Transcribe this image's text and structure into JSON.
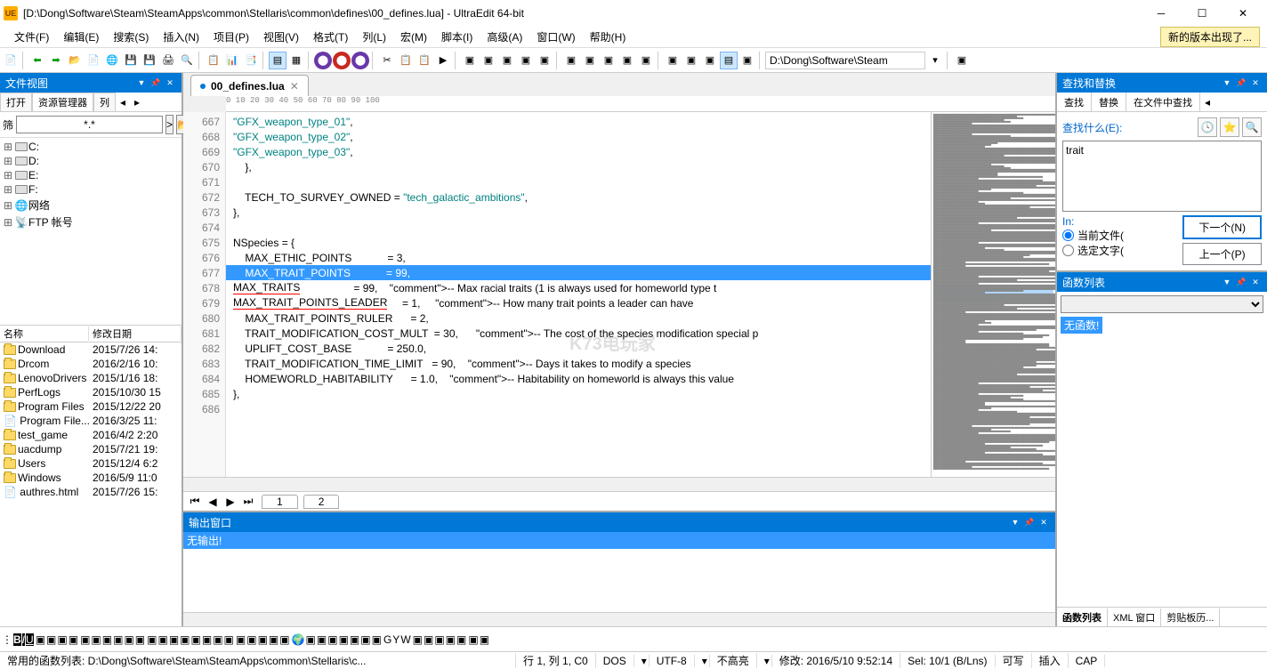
{
  "window": {
    "title": "[D:\\Dong\\Software\\Steam\\SteamApps\\common\\Stellaris\\common\\defines\\00_defines.lua] - UltraEdit 64-bit"
  },
  "menu": {
    "items": [
      "文件(F)",
      "编辑(E)",
      "搜索(S)",
      "插入(N)",
      "项目(P)",
      "视图(V)",
      "格式(T)",
      "列(L)",
      "宏(M)",
      "脚本(I)",
      "高级(A)",
      "窗口(W)",
      "帮助(H)"
    ],
    "update_notice": "新的版本出现了..."
  },
  "toolbar_path": "D:\\Dong\\Software\\Steam",
  "file_view": {
    "title": "文件视图",
    "tab_open": "打开",
    "tab_explorer": "资源管理器",
    "tab_list": "列",
    "filter_label": "筛",
    "filter_value": "*.*",
    "drives": [
      "C:",
      "D:",
      "E:",
      "F:"
    ],
    "network": "网络",
    "ftp": "FTP 帐号",
    "col_name": "名称",
    "col_date": "修改日期",
    "files": [
      {
        "name": "Download",
        "date": "2015/7/26 14:"
      },
      {
        "name": "Drcom",
        "date": "2016/2/16 10:"
      },
      {
        "name": "LenovoDrivers",
        "date": "2015/1/16 18:"
      },
      {
        "name": "PerfLogs",
        "date": "2015/10/30 15"
      },
      {
        "name": "Program Files",
        "date": "2015/12/22 20"
      },
      {
        "name": "Program File...",
        "date": "2016/3/25 11:"
      },
      {
        "name": "test_game",
        "date": "2016/4/2 2:20"
      },
      {
        "name": "uacdump",
        "date": "2015/7/21 19:"
      },
      {
        "name": "Users",
        "date": "2015/12/4 6:2"
      },
      {
        "name": "Windows",
        "date": "2016/5/9 11:0"
      },
      {
        "name": "authres.html",
        "date": "2015/7/26 15:"
      }
    ]
  },
  "editor": {
    "tab_name": "00_defines.lua",
    "lines": [
      {
        "n": 667,
        "t": "        \"GFX_weapon_type_01\","
      },
      {
        "n": 668,
        "t": "        \"GFX_weapon_type_02\","
      },
      {
        "n": 669,
        "t": "        \"GFX_weapon_type_03\","
      },
      {
        "n": 670,
        "t": "    },"
      },
      {
        "n": 671,
        "t": ""
      },
      {
        "n": 672,
        "t": "    TECH_TO_SURVEY_OWNED = \"tech_galactic_ambitions\","
      },
      {
        "n": 673,
        "t": "},"
      },
      {
        "n": 674,
        "t": ""
      },
      {
        "n": 675,
        "t": "NSpecies = {"
      },
      {
        "n": 676,
        "t": "    MAX_ETHIC_POINTS            = 3,"
      },
      {
        "n": 677,
        "t": "    MAX_TRAIT_POINTS            = 99,",
        "hl": true
      },
      {
        "n": 678,
        "t": "    MAX_TRAITS                  = 99,    -- Max racial traits (1 is always used for homeworld type t"
      },
      {
        "n": 679,
        "t": "    MAX_TRAIT_POINTS_LEADER     = 1,     -- How many trait points a leader can have"
      },
      {
        "n": 680,
        "t": "    MAX_TRAIT_POINTS_RULER      = 2,"
      },
      {
        "n": 681,
        "t": "    TRAIT_MODIFICATION_COST_MULT  = 30,      -- The cost of the species modification special p"
      },
      {
        "n": 682,
        "t": "    UPLIFT_COST_BASE            = 250.0,"
      },
      {
        "n": 683,
        "t": "    TRAIT_MODIFICATION_TIME_LIMIT   = 90,    -- Days it takes to modify a species"
      },
      {
        "n": 684,
        "t": "    HOMEWORLD_HABITABILITY      = 1.0,    -- Habitability on homeworld is always this value"
      },
      {
        "n": 685,
        "t": "},"
      },
      {
        "n": 686,
        "t": ""
      }
    ]
  },
  "output": {
    "title": "输出窗口",
    "message": "无输出!"
  },
  "pages": [
    "1",
    "2"
  ],
  "search": {
    "title": "查找和替换",
    "tab_find": "查找",
    "tab_replace": "替换",
    "tab_infiles": "在文件中查找",
    "label_what": "查找什么(E):",
    "value": "trait",
    "label_in": "In:",
    "radio_current": "当前文件(",
    "radio_selected": "选定文字(",
    "btn_next": "下一个(N)",
    "btn_prev": "上一个(P)"
  },
  "fnlist": {
    "title": "函数列表",
    "empty": "无函数!",
    "tab_fn": "函数列表",
    "tab_xml": "XML 窗口",
    "tab_clip": "剪贴板历..."
  },
  "status": {
    "fn_path": "常用的函数列表: D:\\Dong\\Software\\Steam\\SteamApps\\common\\Stellaris\\c...",
    "pos": "行 1, 列 1, C0",
    "fmt": "DOS",
    "enc": "UTF-8",
    "hl": "不高亮",
    "mod": "修改: 2016/5/10 9:52:14",
    "sel": "Sel: 10/1 (B/Lns)",
    "rw": "可写",
    "ins": "插入",
    "cap": "CAP"
  },
  "watermark": "K73电玩家"
}
